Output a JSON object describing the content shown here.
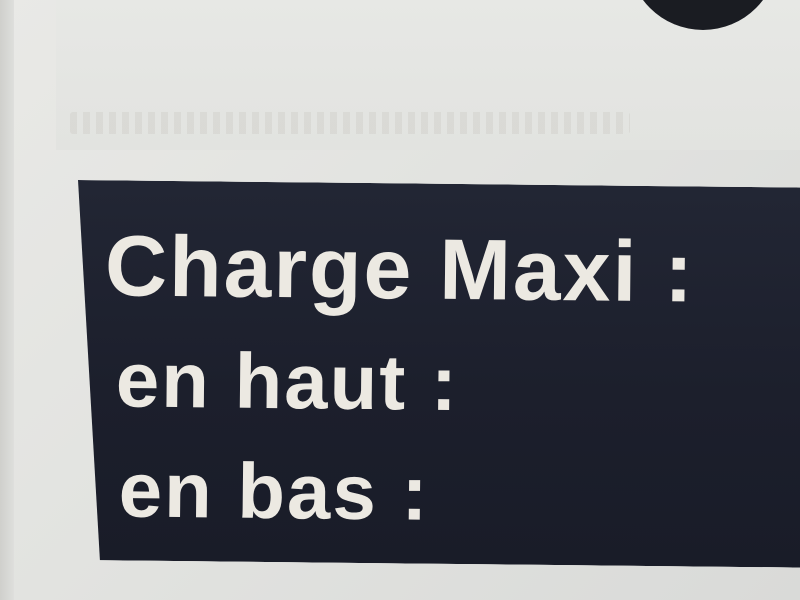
{
  "sign": {
    "line1": "Charge Maxi :",
    "line2": "en haut :",
    "line3": "en bas :"
  },
  "colors": {
    "label_background": "#1c1f2c",
    "label_text": "#ece9e2",
    "board_background": "#e4e4e1",
    "dot": "#1a1c22"
  }
}
